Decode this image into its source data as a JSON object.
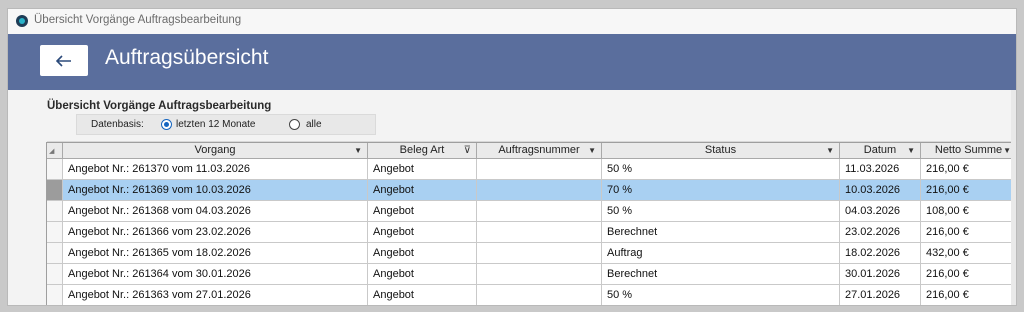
{
  "window": {
    "title": "Übersicht Vorgänge Auftragsbearbeitung"
  },
  "header": {
    "title": "Auftragsübersicht",
    "back_icon": "arrow-left-icon"
  },
  "section": {
    "title": "Übersicht Vorgänge Auftragsbearbeitung"
  },
  "filter": {
    "label": "Datenbasis:",
    "options": [
      {
        "label": "letzten 12 Monate",
        "checked": true
      },
      {
        "label": "alle",
        "checked": false
      }
    ]
  },
  "grid": {
    "columns": [
      "Vorgang",
      "Beleg Art",
      "Auftragsnummer",
      "Status",
      "Datum",
      "Netto Summe"
    ],
    "rows": [
      {
        "vorgang": "Angebot Nr.: 261370 vom 11.03.2026",
        "belegart": "Angebot",
        "auftragsnummer": "",
        "status": "50 %",
        "datum": "11.03.2026",
        "netto": "216,00 €",
        "selected": false
      },
      {
        "vorgang": "Angebot Nr.: 261369 vom 10.03.2026",
        "belegart": "Angebot",
        "auftragsnummer": "",
        "status": "70 %",
        "datum": "10.03.2026",
        "netto": "216,00 €",
        "selected": true
      },
      {
        "vorgang": "Angebot Nr.: 261368 vom 04.03.2026",
        "belegart": "Angebot",
        "auftragsnummer": "",
        "status": "50 %",
        "datum": "04.03.2026",
        "netto": "108,00 €",
        "selected": false
      },
      {
        "vorgang": "Angebot Nr.: 261366 vom 23.02.2026",
        "belegart": "Angebot",
        "auftragsnummer": "",
        "status": "Berechnet",
        "datum": "23.02.2026",
        "netto": "216,00 €",
        "selected": false
      },
      {
        "vorgang": "Angebot Nr.: 261365 vom 18.02.2026",
        "belegart": "Angebot",
        "auftragsnummer": "",
        "status": "Auftrag",
        "datum": "18.02.2026",
        "netto": "432,00 €",
        "selected": false
      },
      {
        "vorgang": "Angebot Nr.: 261364 vom 30.01.2026",
        "belegart": "Angebot",
        "auftragsnummer": "",
        "status": "Berechnet",
        "datum": "30.01.2026",
        "netto": "216,00 €",
        "selected": false
      },
      {
        "vorgang": "Angebot Nr.: 261363 vom 27.01.2026",
        "belegart": "Angebot",
        "auftragsnummer": "",
        "status": "50 %",
        "datum": "27.01.2026",
        "netto": "216,00 €",
        "selected": false
      }
    ]
  },
  "colors": {
    "header_bg": "#5a6e9d",
    "selected_row": "#a9d0f2",
    "radio_accent": "#1565c0"
  }
}
